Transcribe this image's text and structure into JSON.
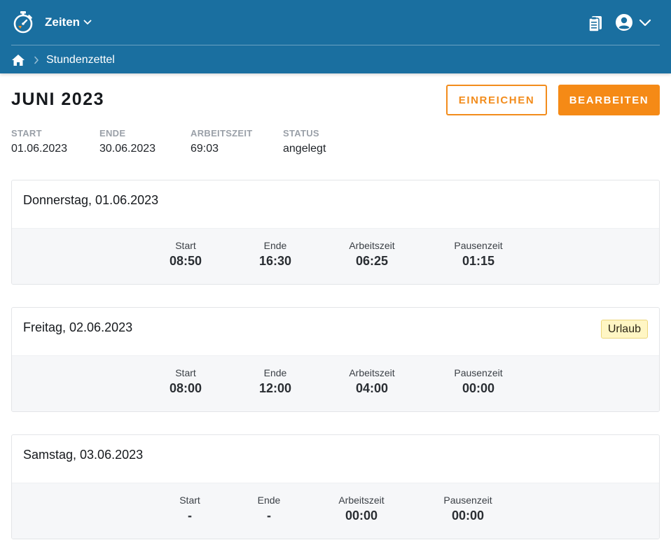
{
  "header": {
    "app_name": "Zeiten",
    "icons": {
      "logo": "stopwatch-logo-icon",
      "app_menu": "chevron-down-icon",
      "clipboard": "clipboard-icon",
      "user": "user-circle-icon",
      "user_menu": "chevron-down-icon"
    }
  },
  "breadcrumb": {
    "home_icon": "home-icon",
    "separator_icon": "chevron-right-icon",
    "current": "Stundenzettel"
  },
  "page": {
    "title": "JUNI 2023",
    "buttons": {
      "submit": "EINREICHEN",
      "edit": "BEARBEITEN"
    }
  },
  "summary": [
    {
      "label": "START",
      "value": "01.06.2023"
    },
    {
      "label": "ENDE",
      "value": "30.06.2023"
    },
    {
      "label": "ARBEITSZEIT",
      "value": "69:03"
    },
    {
      "label": "STATUS",
      "value": "angelegt"
    }
  ],
  "days": [
    {
      "date": "Donnerstag, 01.06.2023",
      "badge": "",
      "stats": [
        {
          "label": "Start",
          "value": "08:50"
        },
        {
          "label": "Ende",
          "value": "16:30"
        },
        {
          "label": "Arbeitszeit",
          "value": "06:25"
        },
        {
          "label": "Pausenzeit",
          "value": "01:15"
        }
      ]
    },
    {
      "date": "Freitag, 02.06.2023",
      "badge": "Urlaub",
      "stats": [
        {
          "label": "Start",
          "value": "08:00"
        },
        {
          "label": "Ende",
          "value": "12:00"
        },
        {
          "label": "Arbeitszeit",
          "value": "04:00"
        },
        {
          "label": "Pausenzeit",
          "value": "00:00"
        }
      ]
    },
    {
      "date": "Samstag, 03.06.2023",
      "badge": "",
      "stats": [
        {
          "label": "Start",
          "value": "-"
        },
        {
          "label": "Ende",
          "value": "-"
        },
        {
          "label": "Arbeitszeit",
          "value": "00:00"
        },
        {
          "label": "Pausenzeit",
          "value": "00:00"
        }
      ]
    }
  ],
  "colors": {
    "header_bg": "#1a6fa0",
    "accent": "#f58a16",
    "badge_bg": "#fff6c4"
  }
}
